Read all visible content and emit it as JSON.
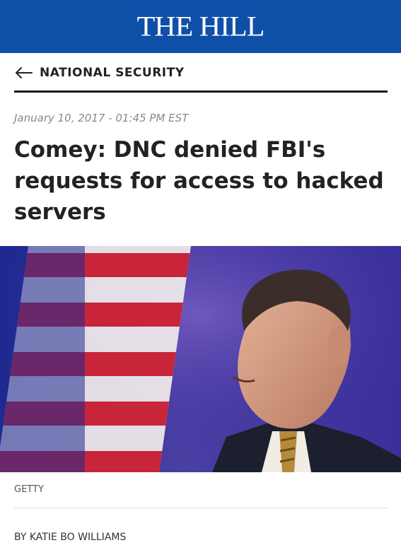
{
  "header": {
    "brand": "THE HILL",
    "brand_color": "#0e4fa8"
  },
  "section": {
    "back_icon": "arrow-left-icon",
    "label": "NATIONAL SECURITY"
  },
  "article": {
    "dateline": "January 10, 2017 - 01:45 PM EST",
    "headline": "Comey: DNC denied FBI's requests for access to hacked servers",
    "photo": {
      "description_icon": "hero-photo",
      "credit": "GETTY"
    },
    "byline": "BY KATIE BO WILLIAMS"
  }
}
